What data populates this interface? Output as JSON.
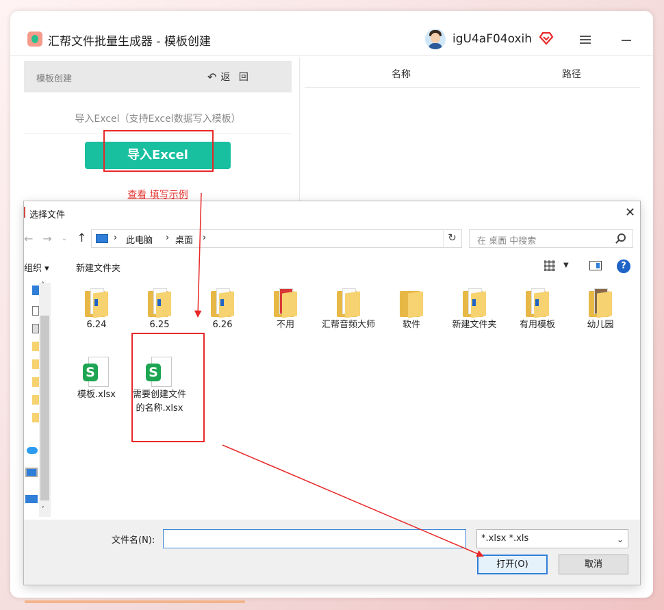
{
  "app": {
    "title": "汇帮文件批量生成器 - 模板创建",
    "username": "igU4aF04oxih"
  },
  "left_panel": {
    "header_title": "模板创建",
    "back_label": "返 回",
    "hint": "导入Excel（支持Excel数据写入模板）",
    "import_button": "导入Excel",
    "example_link": "查看 填写示例"
  },
  "right_panel": {
    "columns": [
      "名称",
      "路径"
    ]
  },
  "dialog": {
    "title": "选择文件",
    "breadcrumb": [
      "此电脑",
      "桌面"
    ],
    "search_placeholder": "在 桌面 中搜索",
    "toolbar": {
      "organize": "组织 ▾",
      "new_folder": "新建文件夹"
    },
    "folders": [
      "6.24",
      "6.25",
      "6.26",
      "不用",
      "汇帮音频大师",
      "软件",
      "新建文件夹",
      "有用模板",
      "幼儿园"
    ],
    "files": [
      "模板.xlsx",
      "需要创建文件的名称.xlsx"
    ],
    "filename_label": "文件名(N):",
    "filename_value": "",
    "filter_value": "*.xlsx *.xls",
    "open_button": "打开(O)",
    "cancel_button": "取消"
  },
  "colors": {
    "accent": "#18c0a0",
    "annotation": "#e82828",
    "link": "#e53935",
    "folder": "#f6d270",
    "sheet_logo": "#1da553"
  }
}
